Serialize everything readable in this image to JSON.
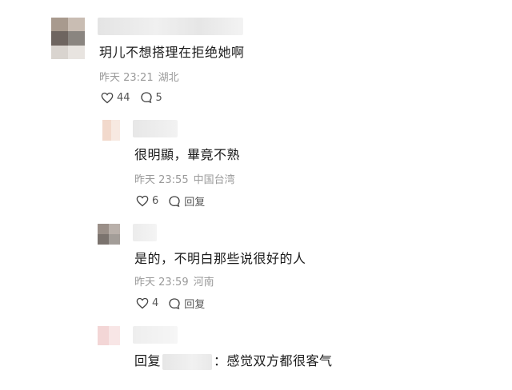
{
  "comments": [
    {
      "text": "玥儿不想搭理在拒绝她啊",
      "time": "昨天 23:21",
      "location": "湖北",
      "likes": "44",
      "replies": "5"
    },
    {
      "text": "很明顯，畢竟不熟",
      "time": "昨天 23:55",
      "location": "中国台湾",
      "likes": "6",
      "reply_label": "回复"
    },
    {
      "text": "是的，不明白那些说很好的人",
      "time": "昨天 23:59",
      "location": "河南",
      "likes": "4",
      "reply_label": "回复"
    },
    {
      "prefix": "回复",
      "text": "：感觉双方都很客气"
    }
  ]
}
